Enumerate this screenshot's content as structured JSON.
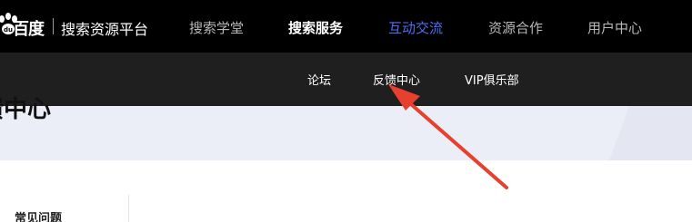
{
  "logo": {
    "brand": "百度",
    "subtitle": "搜索资源平台",
    "paw_color": "#ffffff"
  },
  "topnav": {
    "items": [
      {
        "label": "搜索学堂",
        "state": "normal"
      },
      {
        "label": "搜索服务",
        "state": "bold"
      },
      {
        "label": "互动交流",
        "state": "active"
      },
      {
        "label": "资源合作",
        "state": "normal"
      },
      {
        "label": "用户中心",
        "state": "normal"
      }
    ],
    "active_color": "#4e6ef2"
  },
  "subnav": {
    "items": [
      {
        "label": "论坛"
      },
      {
        "label": "反馈中心"
      },
      {
        "label": "VIP俱乐部"
      }
    ]
  },
  "page": {
    "title": "馈中心"
  },
  "sidebar": {
    "heading": "常见问题"
  },
  "annotation": {
    "arrow_color": "#e8402f",
    "points_to": "反馈中心"
  }
}
